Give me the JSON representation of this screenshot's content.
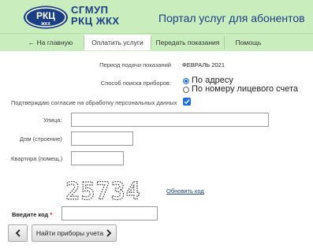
{
  "header": {
    "logo_text": "РКЦ",
    "logo_subtext": "ЖКХ",
    "org_line1": "СГМУП",
    "org_line2": "РКЦ ЖКХ",
    "portal_title": "Портал услуг для абонентов"
  },
  "nav": {
    "home": "← На главную",
    "pay": "Оплатить услуги",
    "readings": "Передать показания",
    "help": "Помощь",
    "active": "pay"
  },
  "form": {
    "period_label": "Период подачи показаний",
    "period_value": "ФЕВРАЛЬ 2021",
    "search_method_label": "Способ поиска приборов:",
    "option_address": "По адресу",
    "option_account": "По номеру лицевого счета",
    "selected_option": "address",
    "consent_label": "Подтверждаю согласие на обработку персональных данных",
    "consent_checked": true,
    "street_label": "Улица:",
    "street_value": "",
    "house_label": "Дом (строение)",
    "house_value": "",
    "apartment_label": "Квартира (помещ.)",
    "apartment_value": "",
    "captcha_text": "25734",
    "refresh_label": "Обновить код",
    "code_label": "Введите код",
    "required_mark": "*",
    "code_value": ""
  },
  "buttons": {
    "back_icon": "chevron-left-icon",
    "next_label": "Найти приборы учета",
    "next_icon": "chevron-right-icon"
  },
  "colors": {
    "header_bg": "#c9edbd",
    "brand_blue": "#1a3f85",
    "accent_blue": "#1e6ee0",
    "required_red": "#cc0000"
  }
}
